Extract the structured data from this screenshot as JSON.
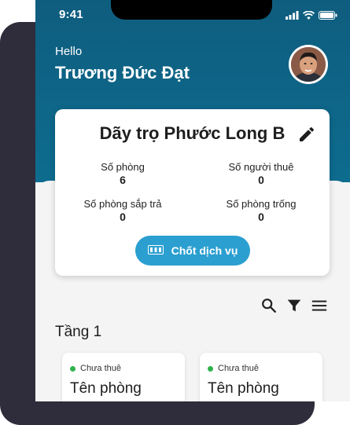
{
  "status_bar": {
    "time": "9:41"
  },
  "header": {
    "greeting": "Hello",
    "user_name": "Trương Đức Đạt"
  },
  "card": {
    "title": "Dãy trọ Phước Long B",
    "stats": [
      {
        "label": "Số phòng",
        "value": "6"
      },
      {
        "label": "Số người thuê",
        "value": "0"
      },
      {
        "label": "Số phòng sắp trả",
        "value": "0"
      },
      {
        "label": "Số phòng trống",
        "value": "0"
      }
    ],
    "service_button": "Chốt dịch vụ"
  },
  "floor": {
    "title": "Tầng 1",
    "rooms": [
      {
        "status": "Chưa thuê",
        "name": "Tên phòng"
      },
      {
        "status": "Chưa thuê",
        "name": "Tên phòng"
      }
    ]
  },
  "colors": {
    "header": "#0f5d7e",
    "accent": "#2a9fd0",
    "available": "#2fb24c"
  },
  "icons": [
    "signal-icon",
    "wifi-icon",
    "battery-icon",
    "edit-icon",
    "meter-icon",
    "search-icon",
    "filter-icon",
    "menu-icon"
  ]
}
